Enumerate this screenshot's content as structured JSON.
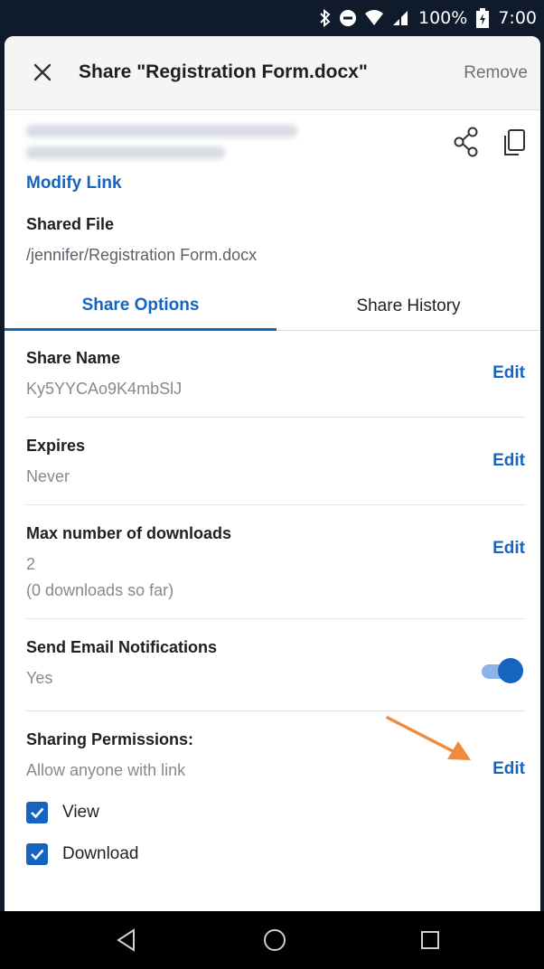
{
  "status_bar": {
    "battery_text": "100%",
    "time": "7:00",
    "icons": [
      "bluetooth-icon",
      "do-not-disturb-icon",
      "wifi-icon",
      "signal-icon",
      "battery-icon"
    ]
  },
  "header": {
    "title": "Share \"Registration Form.docx\"",
    "remove_label": "Remove",
    "close_icon": "close-icon"
  },
  "link": {
    "modify_label": "Modify Link",
    "share_icon": "share-icon",
    "copy_icon": "copy-icon"
  },
  "shared_file": {
    "label": "Shared File",
    "path": "/jennifer/Registration Form.docx"
  },
  "tabs": [
    {
      "label": "Share Options",
      "active": true
    },
    {
      "label": "Share History",
      "active": false
    }
  ],
  "options": {
    "share_name": {
      "label": "Share Name",
      "value": "Ky5YYCAo9K4mbSlJ",
      "edit": "Edit"
    },
    "expires": {
      "label": "Expires",
      "value": "Never",
      "edit": "Edit"
    },
    "max_downloads": {
      "label": "Max number of downloads",
      "value": "2",
      "note": "(0 downloads so far)",
      "edit": "Edit"
    },
    "email_notifications": {
      "label": "Send Email Notifications",
      "value": "Yes",
      "enabled": true
    },
    "permissions": {
      "label": "Sharing Permissions:",
      "value": "Allow anyone with link",
      "edit": "Edit"
    }
  },
  "permissions_checks": [
    {
      "label": "View",
      "checked": true
    },
    {
      "label": "Download",
      "checked": true
    }
  ],
  "colors": {
    "accent": "#1565c0",
    "arrow": "#f08a3c",
    "status_bar": "#0f1a2b"
  },
  "nav": [
    "back-icon",
    "home-icon",
    "recents-icon"
  ]
}
